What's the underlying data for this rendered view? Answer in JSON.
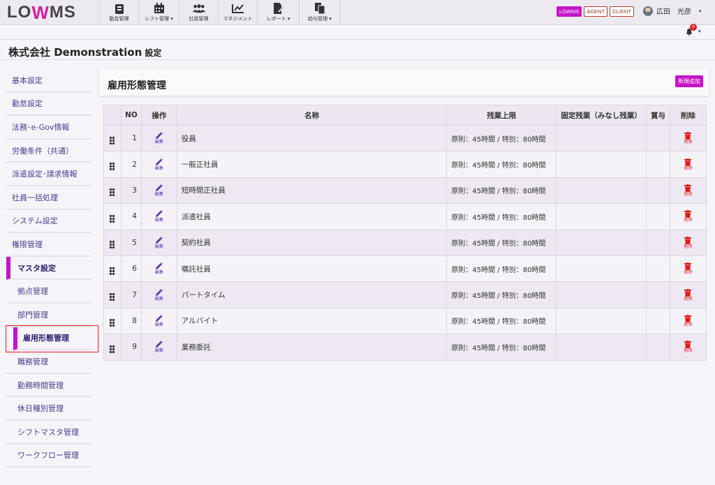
{
  "brand": {
    "logo_pre": "LO",
    "logo_w": "W",
    "logo_post": "MS",
    "accent": "#c514c8"
  },
  "nav": [
    {
      "label": "勤怠管理",
      "icon": "clipboard-icon"
    },
    {
      "label": "シフト管理 ▾",
      "icon": "calendar-icon"
    },
    {
      "label": "社員管理",
      "icon": "users-icon"
    },
    {
      "label": "マネジメント",
      "icon": "chart-line-icon"
    },
    {
      "label": "レポート ▾",
      "icon": "report-edit-icon"
    },
    {
      "label": "給与管理 ▾",
      "icon": "documents-icon"
    }
  ],
  "badges": {
    "lowms": "LOWMS",
    "agent": "AGENT",
    "client": "CLIENT"
  },
  "user": {
    "name": "広田　光彦",
    "caret": "▾"
  },
  "notifications": {
    "count": "0",
    "caret": "▾"
  },
  "page": {
    "company": "株式会社 Demonstration",
    "section": "設定"
  },
  "sidebar": {
    "items": [
      {
        "label": "基本設定"
      },
      {
        "label": "勤怠設定"
      },
      {
        "label": "法務･e-Gov情報"
      },
      {
        "label": "労働条件（共通）"
      },
      {
        "label": "派遣設定･請求情報"
      },
      {
        "label": "社員一括処理"
      },
      {
        "label": "システム設定"
      },
      {
        "label": "権限管理"
      },
      {
        "label": "マスタ設定"
      },
      {
        "label": "拠点管理"
      },
      {
        "label": "部門管理"
      },
      {
        "label": "雇用形態管理"
      },
      {
        "label": "職務管理"
      },
      {
        "label": "勤務時間管理"
      },
      {
        "label": "休日種別管理"
      },
      {
        "label": "シフトマスタ管理"
      },
      {
        "label": "ワークフロー管理"
      }
    ]
  },
  "main": {
    "title": "雇用形態管理",
    "add_button": "新規追加",
    "columns": {
      "no": "NO",
      "ops": "操作",
      "name": "名称",
      "ot_limit": "残業上限",
      "fixed_ot": "固定残業（みなし残業）",
      "bonus": "賞与",
      "delete": "削除"
    },
    "edit_label": "編集",
    "delete_label": "削除",
    "rows": [
      {
        "no": "1",
        "name": "役員",
        "ot_limit": "原則：45時間 / 特別：80時間"
      },
      {
        "no": "2",
        "name": "一般正社員",
        "ot_limit": "原則：45時間 / 特別：80時間"
      },
      {
        "no": "3",
        "name": "短時間正社員",
        "ot_limit": "原則：45時間 / 特別：80時間"
      },
      {
        "no": "4",
        "name": "派遣社員",
        "ot_limit": "原則：45時間 / 特別：80時間"
      },
      {
        "no": "5",
        "name": "契約社員",
        "ot_limit": "原則：45時間 / 特別：80時間"
      },
      {
        "no": "6",
        "name": "嘱託社員",
        "ot_limit": "原則：45時間 / 特別：80時間"
      },
      {
        "no": "7",
        "name": "パートタイム",
        "ot_limit": "原則：45時間 / 特別：80時間"
      },
      {
        "no": "8",
        "name": "アルバイト",
        "ot_limit": "原則：45時間 / 特別：80時間"
      },
      {
        "no": "9",
        "name": "業務委託",
        "ot_limit": "原則：45時間 / 特別：80時間"
      }
    ]
  }
}
